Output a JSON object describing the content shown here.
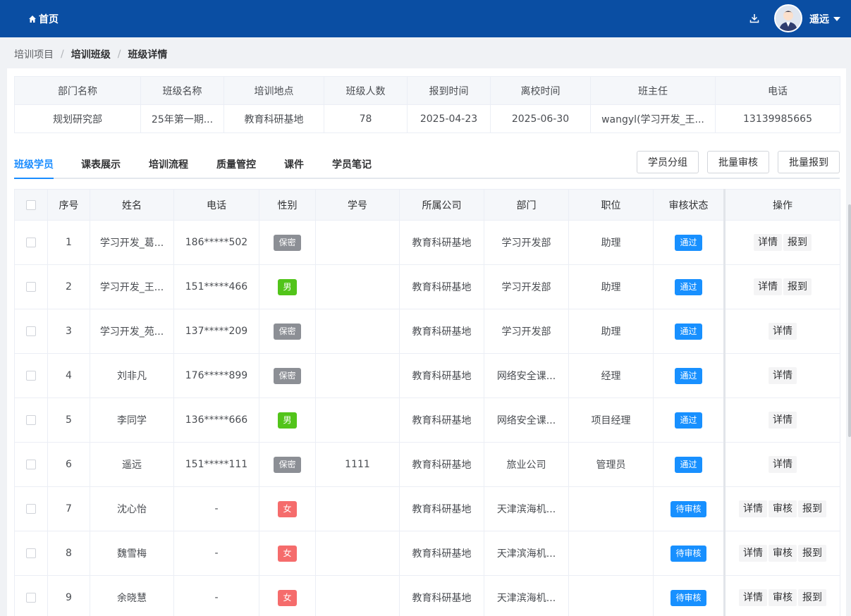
{
  "header": {
    "home_label": "首页",
    "user_name": "遥远"
  },
  "breadcrumb": [
    "培训项目",
    "培训班级",
    "班级详情"
  ],
  "class_info": {
    "headers": [
      "部门名称",
      "班级名称",
      "培训地点",
      "班级人数",
      "报到时间",
      "离校时间",
      "班主任",
      "电话"
    ],
    "values": [
      "规划研究部",
      "25年第一期...",
      "教育科研基地",
      "78",
      "2025-04-23",
      "2025-06-30",
      "wangyl(学习开发_王...",
      "13139985665"
    ]
  },
  "tabs": [
    "班级学员",
    "课表展示",
    "培训流程",
    "质量管控",
    "课件",
    "学员笔记"
  ],
  "actions": {
    "group": "学员分组",
    "batch_review": "批量审核",
    "batch_checkin": "批量报到"
  },
  "table": {
    "headers": [
      "序号",
      "姓名",
      "电话",
      "性别",
      "学号",
      "所属公司",
      "部门",
      "职位",
      "审核状态",
      "操作"
    ],
    "rows": [
      {
        "no": "1",
        "name": "学习开发_葛...",
        "phone": "186*****502",
        "gender": "保密",
        "student_id": "",
        "company": "教育科研基地",
        "dept": "学习开发部",
        "position": "助理",
        "status": "通过",
        "ops": [
          "详情",
          "报到"
        ]
      },
      {
        "no": "2",
        "name": "学习开发_王...",
        "phone": "151*****466",
        "gender": "男",
        "student_id": "",
        "company": "教育科研基地",
        "dept": "学习开发部",
        "position": "助理",
        "status": "通过",
        "ops": [
          "详情",
          "报到"
        ]
      },
      {
        "no": "3",
        "name": "学习开发_苑...",
        "phone": "137*****209",
        "gender": "保密",
        "student_id": "",
        "company": "教育科研基地",
        "dept": "学习开发部",
        "position": "助理",
        "status": "通过",
        "ops": [
          "详情"
        ]
      },
      {
        "no": "4",
        "name": "刘非凡",
        "phone": "176*****899",
        "gender": "保密",
        "student_id": "",
        "company": "教育科研基地",
        "dept": "网络安全课...",
        "position": "经理",
        "status": "通过",
        "ops": [
          "详情"
        ]
      },
      {
        "no": "5",
        "name": "李同学",
        "phone": "136*****666",
        "gender": "男",
        "student_id": "",
        "company": "教育科研基地",
        "dept": "网络安全课...",
        "position": "项目经理",
        "status": "通过",
        "ops": [
          "详情"
        ]
      },
      {
        "no": "6",
        "name": "遥远",
        "phone": "151*****111",
        "gender": "保密",
        "student_id": "1111",
        "company": "教育科研基地",
        "dept": "旅业公司",
        "position": "管理员",
        "status": "通过",
        "ops": [
          "详情"
        ]
      },
      {
        "no": "7",
        "name": "沈心怡",
        "phone": "-",
        "gender": "女",
        "student_id": "",
        "company": "教育科研基地",
        "dept": "天津滨海机...",
        "position": "",
        "status": "待审核",
        "ops": [
          "详情",
          "审核",
          "报到"
        ]
      },
      {
        "no": "8",
        "name": "魏雪梅",
        "phone": "-",
        "gender": "女",
        "student_id": "",
        "company": "教育科研基地",
        "dept": "天津滨海机...",
        "position": "",
        "status": "待审核",
        "ops": [
          "详情",
          "审核",
          "报到"
        ]
      },
      {
        "no": "9",
        "name": "余晓慧",
        "phone": "-",
        "gender": "女",
        "student_id": "",
        "company": "教育科研基地",
        "dept": "天津滨海机...",
        "position": "",
        "status": "待审核",
        "ops": [
          "详情",
          "审核",
          "报到"
        ]
      }
    ]
  },
  "colors": {
    "header_bg": "#0a4ea3",
    "accent": "#1a8cff",
    "status_tag": "#1890ff",
    "gender_secret": "#8c8f95",
    "gender_male": "#52c41a",
    "gender_female": "#f56c6c"
  },
  "icons": {
    "home": "home-icon",
    "download": "download-icon",
    "dropdown": "caret-down-icon"
  }
}
